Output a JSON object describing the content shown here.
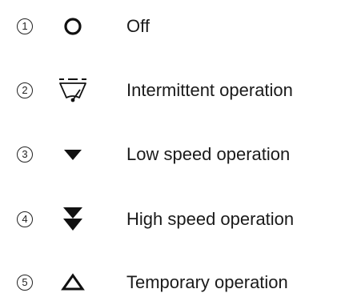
{
  "items": [
    {
      "number": "1",
      "icon": "circle-icon",
      "label": "Off"
    },
    {
      "number": "2",
      "icon": "wiper-intermittent-icon",
      "label": "Intermittent operation"
    },
    {
      "number": "3",
      "icon": "triangle-down-icon",
      "label": "Low speed operation"
    },
    {
      "number": "4",
      "icon": "double-triangle-down-icon",
      "label": "High speed operation"
    },
    {
      "number": "5",
      "icon": "triangle-up-outline-icon",
      "label": "Temporary operation"
    }
  ]
}
